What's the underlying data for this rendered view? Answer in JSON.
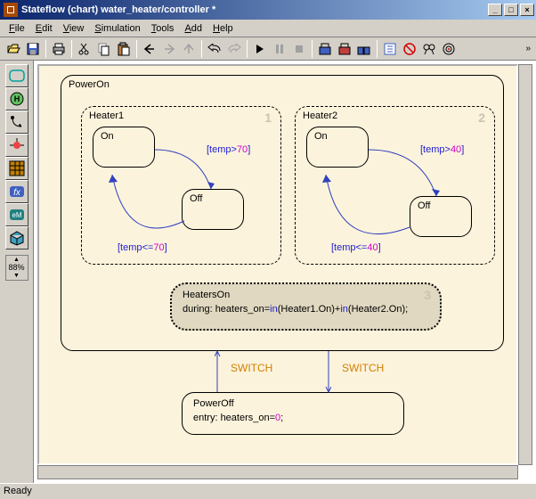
{
  "window": {
    "title": "Stateflow (chart) water_heater/controller *"
  },
  "menu": {
    "file": "File",
    "edit": "Edit",
    "view": "View",
    "simulation": "Simulation",
    "tools": "Tools",
    "add": "Add",
    "help": "Help"
  },
  "zoom": {
    "value": "88",
    "unit": "%"
  },
  "status": {
    "text": "Ready"
  },
  "chart": {
    "poweron": {
      "name": "PowerOn",
      "heater1": {
        "name": "Heater1",
        "num": "1",
        "on_state": "On",
        "off_state": "Off",
        "cond_to_off": "[temp>70]",
        "cond_to_on": "[temp<=70]"
      },
      "heater2": {
        "name": "Heater2",
        "num": "2",
        "on_state": "On",
        "off_state": "Off",
        "cond_to_off": "[temp>40]",
        "cond_to_on": "[temp<=40]"
      },
      "heaterson": {
        "name": "HeatersOn",
        "num": "3",
        "body_prefix": "during: heaters_on=",
        "body_kw1": "in",
        "body_mid1": "(Heater1.On)+",
        "body_kw2": "in",
        "body_mid2": "(Heater2.On);"
      }
    },
    "switch1": "SWITCH",
    "switch2": "SWITCH",
    "poweroff": {
      "name": "PowerOff",
      "body_prefix": "entry: heaters_on=",
      "body_val": "0",
      "body_suffix": ";"
    }
  }
}
